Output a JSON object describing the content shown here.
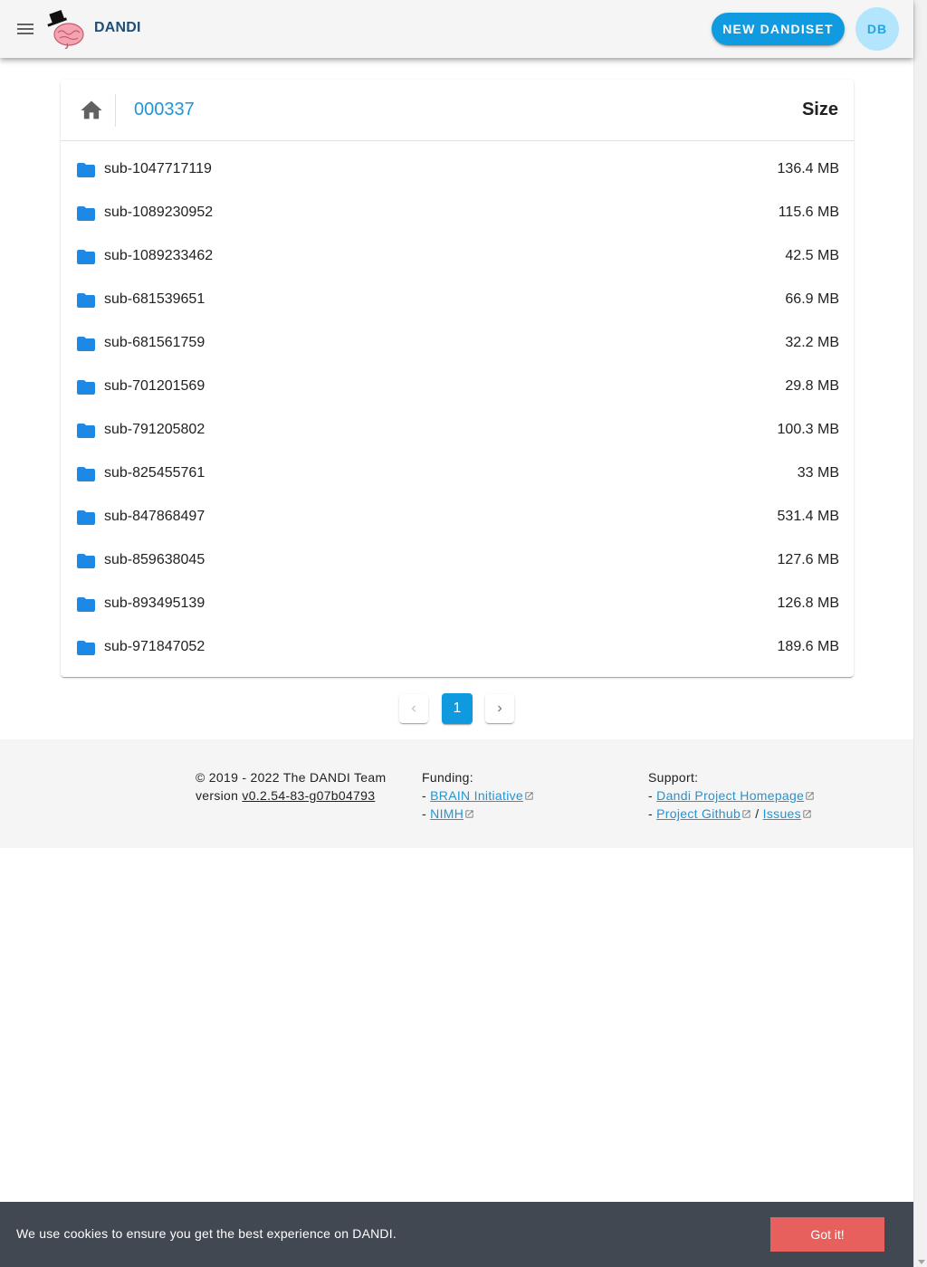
{
  "appbar": {
    "brand": "DANDI",
    "new_dandiset_label": "NEW DANDISET",
    "avatar_initials": "DB"
  },
  "browser": {
    "breadcrumb": "000337",
    "size_header": "Size",
    "rows": [
      {
        "name": "sub-1047717119",
        "size": "136.4 MB"
      },
      {
        "name": "sub-1089230952",
        "size": "115.6 MB"
      },
      {
        "name": "sub-1089233462",
        "size": "42.5 MB"
      },
      {
        "name": "sub-681539651",
        "size": "66.9 MB"
      },
      {
        "name": "sub-681561759",
        "size": "32.2 MB"
      },
      {
        "name": "sub-701201569",
        "size": "29.8 MB"
      },
      {
        "name": "sub-791205802",
        "size": "100.3 MB"
      },
      {
        "name": "sub-825455761",
        "size": "33 MB"
      },
      {
        "name": "sub-847868497",
        "size": "531.4 MB"
      },
      {
        "name": "sub-859638045",
        "size": "127.6 MB"
      },
      {
        "name": "sub-893495139",
        "size": "126.8 MB"
      },
      {
        "name": "sub-971847052",
        "size": "189.6 MB"
      }
    ]
  },
  "pagination": {
    "current_page": "1"
  },
  "footer": {
    "copyright": "© 2019 - 2022 The DANDI Team",
    "version_prefix": "version ",
    "version": "v0.2.54-83-g07b04793",
    "funding_label": "Funding:",
    "funding_links": [
      "BRAIN Initiative",
      "NIMH"
    ],
    "support_label": "Support:",
    "support_homepage": "Dandi Project Homepage",
    "support_github": "Project Github",
    "support_separator": " / ",
    "support_issues": "Issues",
    "dash": "- "
  },
  "cookie": {
    "message": "We use cookies to ensure you get the best experience on DANDI.",
    "button_label": "Got it!"
  },
  "colors": {
    "accent": "#109be0",
    "link": "#1e95d7",
    "folder": "#1e88e5",
    "cookie_bg": "#424851",
    "cookie_button": "#e8605d"
  },
  "icons": {
    "menu": "hamburger-menu-icon",
    "logo": "dandi-brain-logo",
    "home": "home-icon",
    "folder": "folder-icon",
    "prev": "chevron-left-icon",
    "next": "chevron-right-icon",
    "external": "external-link-icon"
  }
}
